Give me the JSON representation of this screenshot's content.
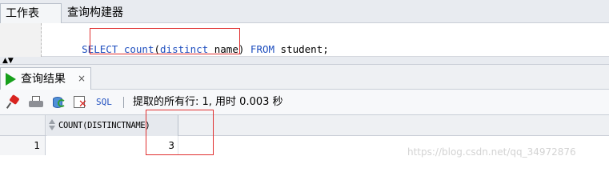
{
  "top_tabs": {
    "worksheet": "工作表",
    "query_builder": "查询构建器"
  },
  "editor": {
    "tokens": [
      {
        "text": "SELECT",
        "type": "kw"
      },
      {
        "text": " ",
        "type": "plain"
      },
      {
        "text": "count",
        "type": "kw"
      },
      {
        "text": "(",
        "type": "plain"
      },
      {
        "text": "distinct",
        "type": "kw"
      },
      {
        "text": " name) ",
        "type": "plain"
      },
      {
        "text": "FROM",
        "type": "kw"
      },
      {
        "text": " student;",
        "type": "plain"
      }
    ]
  },
  "results": {
    "tab_label": "查询结果",
    "close_symbol": "×"
  },
  "toolbar": {
    "sql_label": "SQL",
    "status": "提取的所有行: 1, 用时 0.003 秒"
  },
  "grid": {
    "column_header": "COUNT(DISTINCTNAME)",
    "rows": [
      {
        "row_number": "1",
        "value": "3"
      }
    ]
  },
  "watermark": "https://blog.csdn.net/qq_34972876",
  "colors": {
    "keyword": "#1f4fbf",
    "highlight_box": "#e03030",
    "run_icon": "#18a01c"
  }
}
